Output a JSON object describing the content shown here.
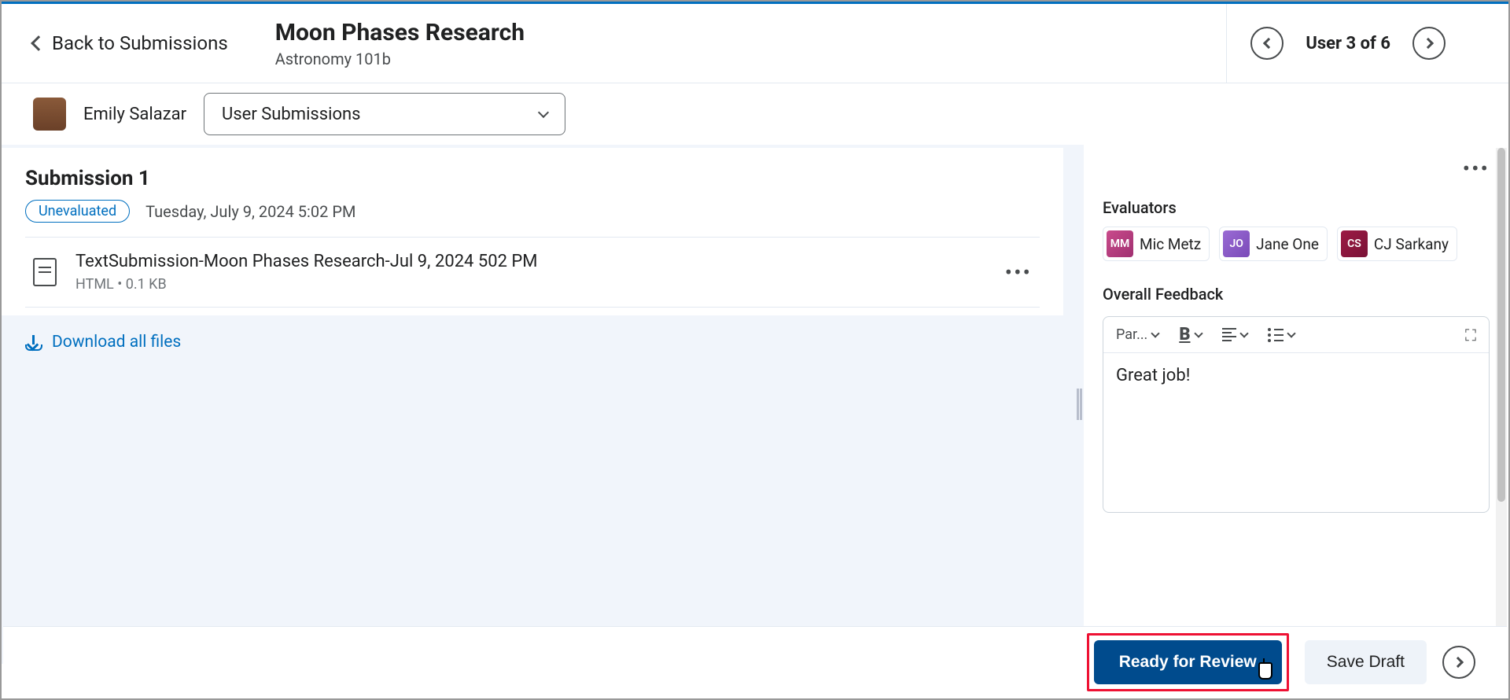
{
  "header": {
    "back_label": "Back to Submissions",
    "title": "Moon Phases Research",
    "subtitle": "Astronomy 101b",
    "user_nav": "User 3 of 6"
  },
  "userbar": {
    "name": "Emily Salazar",
    "dropdown": "User Submissions"
  },
  "submission": {
    "heading": "Submission 1",
    "badge": "Unevaluated",
    "timestamp": "Tuesday, July 9, 2024 5:02 PM",
    "file_name": "TextSubmission-Moon Phases Research-Jul 9, 2024 502 PM",
    "file_meta": "HTML  •  0.1 KB",
    "download": "Download all files"
  },
  "sidebar": {
    "evaluators_label": "Evaluators",
    "evaluators": [
      {
        "initials": "MM",
        "name": "Mic Metz"
      },
      {
        "initials": "JO",
        "name": "Jane One"
      },
      {
        "initials": "CS",
        "name": "CJ Sarkany"
      }
    ],
    "feedback_label": "Overall Feedback",
    "toolbar_para": "Par...",
    "feedback_text": "Great job!"
  },
  "footer": {
    "primary": "Ready for Review",
    "secondary": "Save Draft"
  }
}
